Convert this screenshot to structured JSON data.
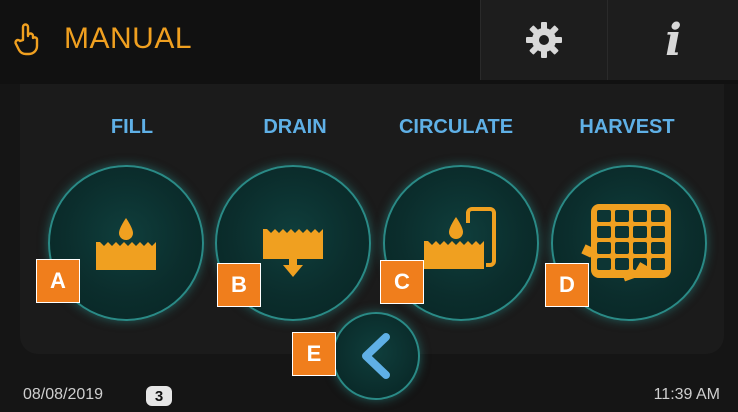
{
  "header": {
    "mode_title": "MANUAL",
    "mode_icon": "hand-pointer-icon",
    "settings_icon": "gear-icon",
    "info_icon": "info-icon",
    "info_glyph": "i"
  },
  "functions": [
    {
      "label": "FILL",
      "icon": "fill-icon",
      "tag": "A"
    },
    {
      "label": "DRAIN",
      "icon": "drain-icon",
      "tag": "B"
    },
    {
      "label": "CIRCULATE",
      "icon": "circulate-icon",
      "tag": "C"
    },
    {
      "label": "HARVEST",
      "icon": "harvest-icon",
      "tag": "D"
    }
  ],
  "back": {
    "icon": "chevron-left-icon",
    "tag": "E"
  },
  "footer": {
    "date": "08/08/2019",
    "day_badge": "3",
    "time": "11:39 AM"
  },
  "colors": {
    "accent": "#f0a020",
    "label_blue": "#5fb0e6",
    "teal_ring": "#2a8a86",
    "tag_orange": "#f07e1c"
  }
}
